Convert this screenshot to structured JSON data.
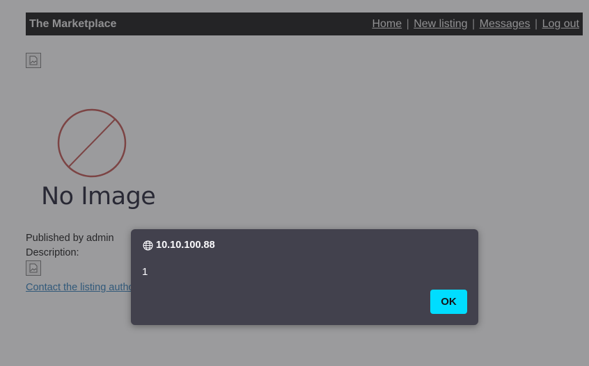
{
  "header": {
    "brand": "The Marketplace",
    "nav": [
      {
        "label": "Home"
      },
      {
        "label": "New listing"
      },
      {
        "label": "Messages"
      },
      {
        "label": "Log out"
      }
    ],
    "separator": "|"
  },
  "listing": {
    "placeholder_text": "No Image",
    "published_by": "Published by admin",
    "description_label": "Description:",
    "contact_link": "Contact the listing author"
  },
  "alert": {
    "origin": "10.10.100.88",
    "message": "1",
    "ok_label": "OK"
  },
  "colors": {
    "topbar": "#111111",
    "dialog_bg": "#42414d",
    "ok_button": "#00ddff",
    "no_image_circle": "#c0504d",
    "link": "#2a7ab8"
  }
}
